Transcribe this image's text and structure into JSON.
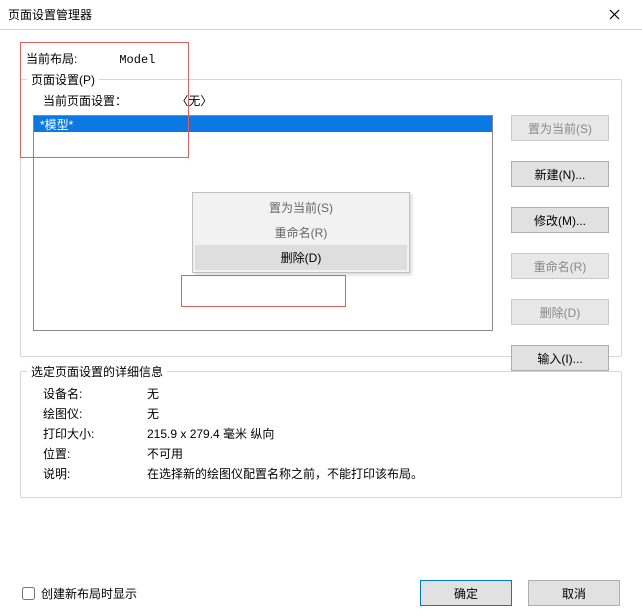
{
  "titlebar": {
    "title": "页面设置管理器"
  },
  "current_layout": {
    "label": "当前布局:",
    "value": "Model"
  },
  "page_setup": {
    "legend": "页面设置(P)",
    "current_label": "当前页面设置：",
    "current_value": "〈无〉",
    "list": {
      "items": [
        "*模型*"
      ],
      "selected_index": 0
    },
    "buttons": {
      "set_current": "置为当前(S)",
      "new": "新建(N)...",
      "modify": "修改(M)...",
      "rename": "重命名(R)",
      "delete": "删除(D)",
      "import": "输入(I)..."
    },
    "context_menu": {
      "set_current": "置为当前(S)",
      "rename": "重命名(R)",
      "delete": "删除(D)"
    }
  },
  "details": {
    "legend": "选定页面设置的详细信息",
    "rows": {
      "device": {
        "k": "设备名:",
        "v": "无"
      },
      "plotter": {
        "k": "绘图仪:",
        "v": "无"
      },
      "size": {
        "k": "打印大小:",
        "v": "215.9 x 279.4 毫米  纵向"
      },
      "where": {
        "k": "位置:",
        "v": "不可用"
      },
      "desc": {
        "k": "说明:",
        "v": "在选择新的绘图仪配置名称之前，不能打印该布局。"
      }
    }
  },
  "footer": {
    "checkbox_label": "创建新布局时显示",
    "ok": "确定",
    "cancel": "取消"
  }
}
